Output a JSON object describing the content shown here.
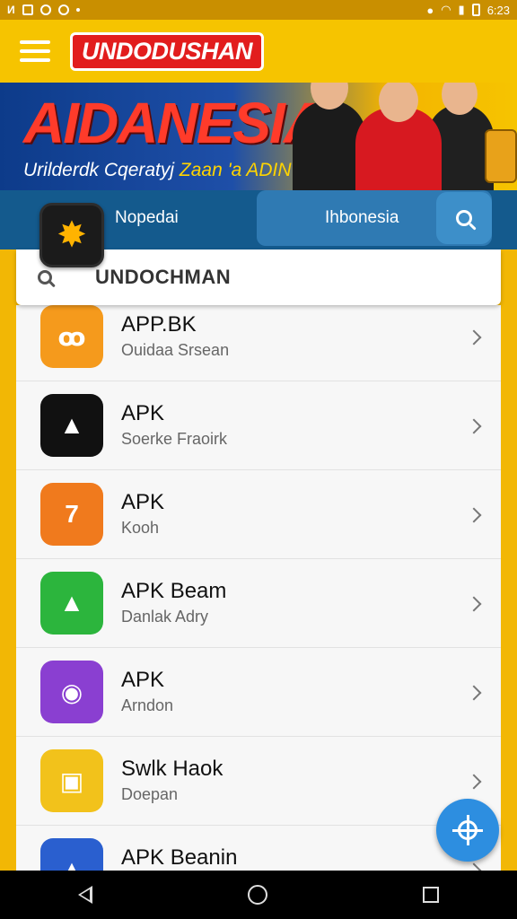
{
  "status_bar": {
    "left_icons": [
      "notification-icon",
      "gallery-icon",
      "whatsapp-icon",
      "sync-icon"
    ],
    "time": "6:23"
  },
  "app_bar": {
    "title": "UNDODUSHAN"
  },
  "banner": {
    "title": "AIDANESIA",
    "subtitle_part1": "Urilderdk Cqeratyj ",
    "subtitle_highlight": "Zaan 'a ADIN"
  },
  "nav": {
    "label": "Nopedai",
    "search_text": "Ihbonesia"
  },
  "search": {
    "value": "UNDOCHMAN"
  },
  "apps": [
    {
      "title": "APP.BK",
      "subtitle": "Ouidaa Srsean",
      "icon": "orange-app-icon",
      "color": "#f59a1c"
    },
    {
      "title": "APK",
      "subtitle": "Soerke Fraoirk",
      "icon": "dark-triangle-app-icon",
      "color": "#111111"
    },
    {
      "title": "APK",
      "subtitle": "Kooh",
      "icon": "orange-shield-app-icon",
      "color": "#f07a1d"
    },
    {
      "title": "APK Beam",
      "subtitle": "Danlak Adry",
      "icon": "green-triangle-app-icon",
      "color": "#2cb53d"
    },
    {
      "title": "APK",
      "subtitle": "Arndon",
      "icon": "purple-app-icon",
      "color": "#8a3fd1"
    },
    {
      "title": "Swlk Haok",
      "subtitle": "Doepan",
      "icon": "yellow-media-app-icon",
      "color": "#f2c21b"
    },
    {
      "title": "APK Beanin",
      "subtitle": "",
      "icon": "blue-triangle-app-icon",
      "color": "#2a5fcf"
    }
  ]
}
